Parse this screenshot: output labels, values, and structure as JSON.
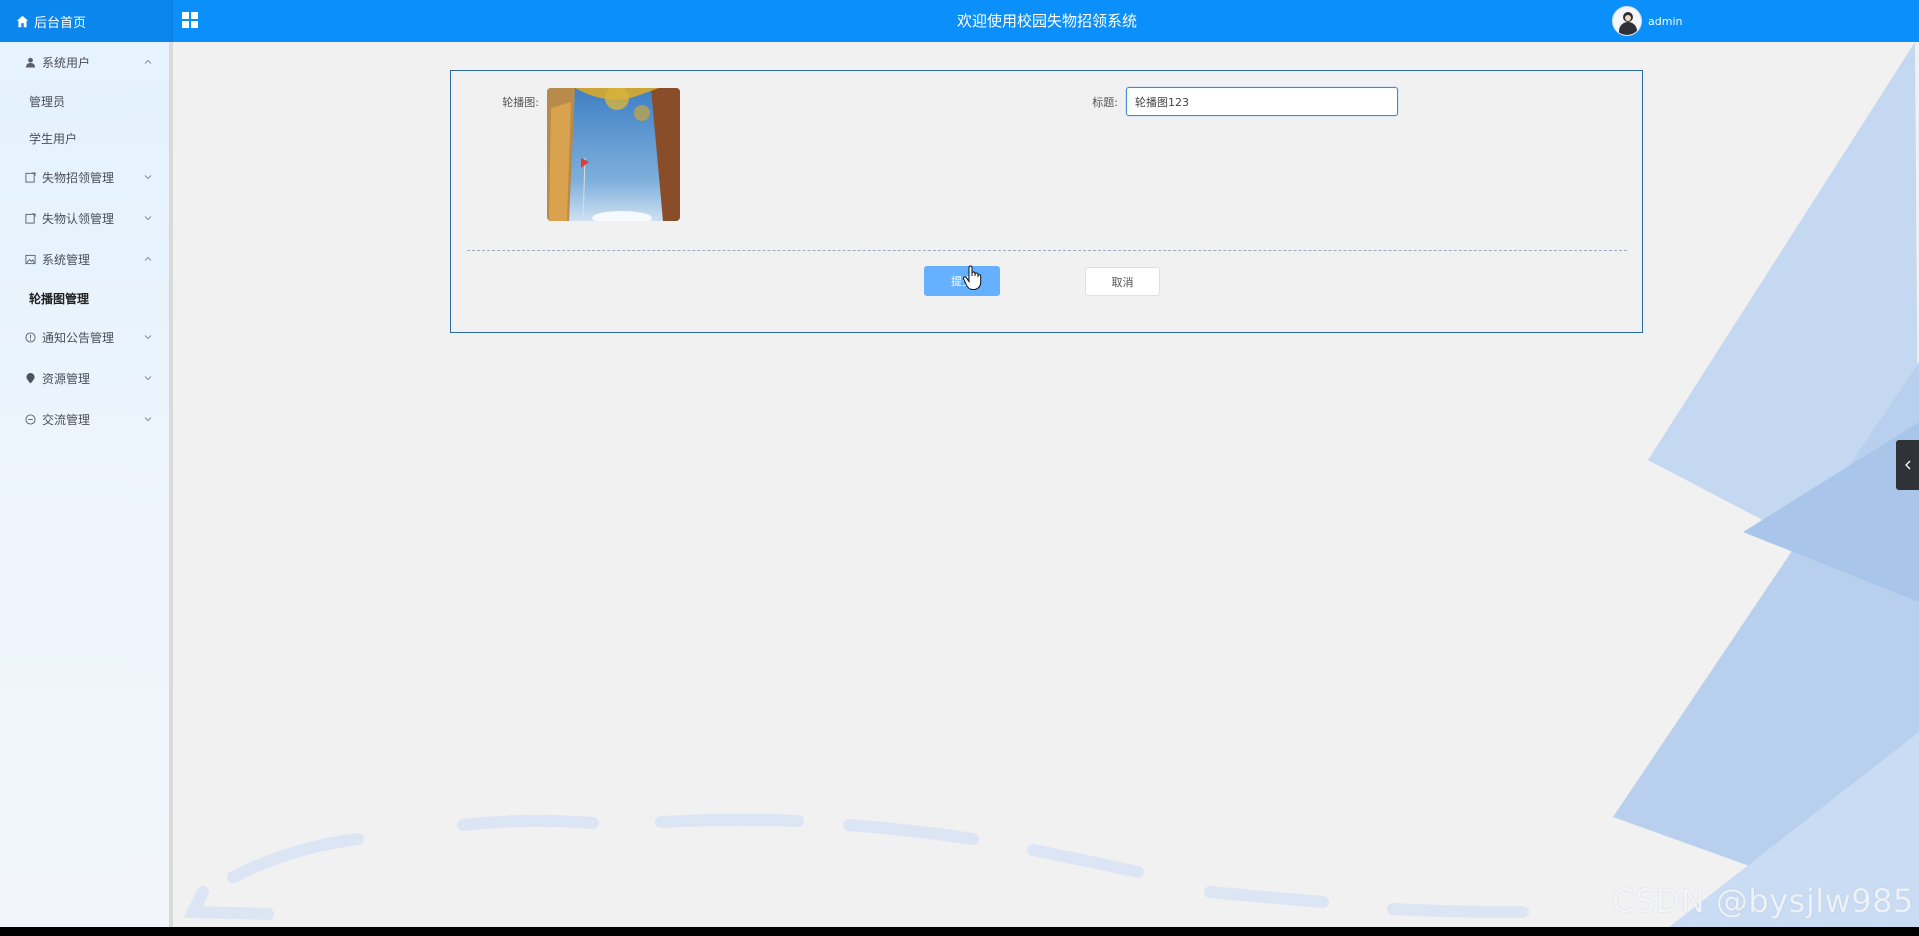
{
  "header": {
    "home_label": "后台首页",
    "title": "欢迎使用校园失物招领系统",
    "username": "admin"
  },
  "sidebar": {
    "items": [
      {
        "label": "系统用户",
        "icon": "user-icon",
        "expanded": true,
        "children": [
          "管理员",
          "学生用户"
        ]
      },
      {
        "label": "失物招领管理",
        "icon": "doc-icon",
        "expanded": false
      },
      {
        "label": "失物认领管理",
        "icon": "doc-icon",
        "expanded": false
      },
      {
        "label": "系统管理",
        "icon": "image-icon",
        "expanded": true,
        "children": [
          "轮播图管理"
        ],
        "active_child": "轮播图管理"
      },
      {
        "label": "通知公告管理",
        "icon": "info-icon",
        "expanded": false
      },
      {
        "label": "资源管理",
        "icon": "location-icon",
        "expanded": false
      },
      {
        "label": "交流管理",
        "icon": "chat-icon",
        "expanded": false
      }
    ]
  },
  "form": {
    "carousel_label": "轮播图:",
    "title_label": "标题:",
    "title_value": "轮播图123",
    "submit_label": "提交",
    "cancel_label": "取消"
  },
  "watermark": "CSDN @bysjlw985",
  "colors": {
    "header_bg": "#0a8ffb",
    "primary_button": "#66b1ff",
    "panel_border": "#2b6aa0"
  }
}
